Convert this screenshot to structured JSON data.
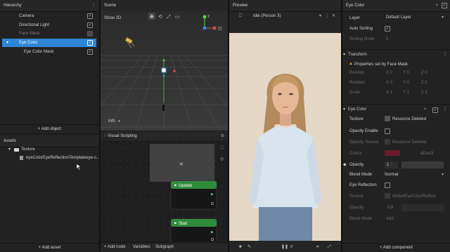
{
  "hierarchy": {
    "title": "Hierarchy",
    "items": [
      {
        "label": "Camera",
        "checked": true
      },
      {
        "label": "Directional Light",
        "checked": true
      },
      {
        "label": "Face Mask",
        "checked": false
      },
      {
        "label": "Eye Color",
        "checked": true
      },
      {
        "label": "Eye Color Mask",
        "checked": true
      }
    ],
    "add_object": "+ Add object"
  },
  "assets": {
    "title": "Assets",
    "folder": "Texture",
    "file": "eyeColorEyeReflectionTemplateeye-c...",
    "add_asset": "+ Add asset"
  },
  "scene": {
    "title": "Scene",
    "show2d": "Show 2D",
    "info": "Info",
    "axis_y": "Y",
    "axis_x": "X"
  },
  "visual_scripting": {
    "title": "Visual Scripting",
    "nodes": [
      {
        "label": "Update"
      },
      {
        "label": "Start"
      }
    ],
    "add_node": "+ Add node",
    "variables": "Variables",
    "subgraph": "Subgraph"
  },
  "preview": {
    "title": "Preview",
    "device": "Idle (Person 3)"
  },
  "inspector": {
    "title": "Eye Color",
    "layer_label": "Layer",
    "layer_value": "Default Layer",
    "auto_sorting": "Auto Sorting",
    "sorting_order_label": "Sorting Order",
    "sorting_order_value": "1",
    "transform": {
      "title": "Transform",
      "warning": "Properties set by Face Mask",
      "position": "Position",
      "rotation": "Rotation",
      "scale": "Scale",
      "position_vals": [
        "X 0",
        "Y 0",
        "Z 0"
      ],
      "rotation_vals": [
        "X 0",
        "Y 0",
        "Z 0"
      ],
      "scale_vals": [
        "X 1",
        "Y 1",
        "Z 1"
      ]
    },
    "eye_color": {
      "title": "Eye Color",
      "texture_label": "Texture",
      "texture_value": "Resource Deleted",
      "opacity_enable": "Opacity Enable",
      "opacity_texture_label": "Opacity Texture",
      "opacity_texture_value": "Resource Deleted",
      "colour_label": "Colour",
      "colour_hex": "af1e43",
      "colour": "#a01e38",
      "opacity_label": "Opacity",
      "opacity_value": "1",
      "blend_mode_label": "Blend Mode",
      "blend_mode_value": "Normal",
      "eye_reflection": "Eye Reflection",
      "texture2_label": "Texture",
      "texture2_value": "defaultEyeColorReflect",
      "opacity2_label": "Opacity",
      "opacity2_value": "0.8",
      "blend2_label": "Blend Mode",
      "blend2_value": "Add"
    },
    "add_component": "+ Add component"
  }
}
